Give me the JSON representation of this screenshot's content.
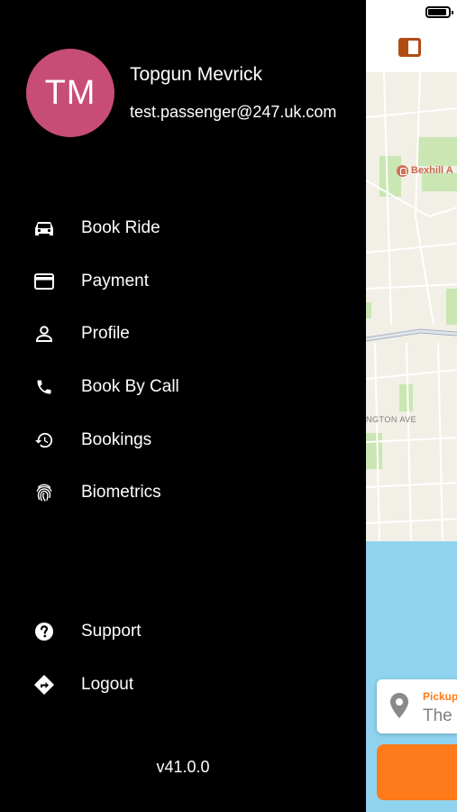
{
  "user": {
    "initials": "TM",
    "name": "Topgun Mevrick",
    "email": "test.passenger@247.uk.com"
  },
  "menu": {
    "primary": [
      {
        "label": "Book Ride",
        "icon": "car-icon"
      },
      {
        "label": "Payment",
        "icon": "credit-card-icon"
      },
      {
        "label": "Profile",
        "icon": "person-icon"
      },
      {
        "label": "Book By Call",
        "icon": "phone-icon"
      },
      {
        "label": "Bookings",
        "icon": "history-icon"
      },
      {
        "label": "Biometrics",
        "icon": "fingerprint-icon"
      }
    ],
    "secondary": [
      {
        "label": "Support",
        "icon": "help-circle-icon"
      },
      {
        "label": "Logout",
        "icon": "directions-icon"
      }
    ]
  },
  "version": "v41.0.0",
  "map": {
    "poi_label": "Bexhill A",
    "street_label": "NGTON AVE"
  },
  "booking": {
    "pickup_label": "Pickup",
    "pickup_value": "The"
  },
  "colors": {
    "avatar": "#c84d76",
    "accent": "#ff7a1a",
    "drawer_background": "#000000",
    "sea": "#8fd3ee"
  }
}
